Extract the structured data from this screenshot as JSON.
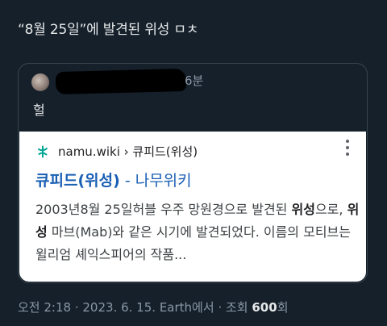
{
  "tweet": {
    "text": "“8월 25일”에 발견된 위성 ㅁㅊ"
  },
  "quote": {
    "time": "6분",
    "body": "헐"
  },
  "search_result": {
    "site": "namu.wiki › 큐피드(위성)",
    "title_main": "큐피드(위성)",
    "title_sep": " - ",
    "title_site": "나무위키",
    "snippet": {
      "p1": "2003년8월 25일허블 우주 망원경으로 발견된 ",
      "b1": "위성",
      "p2": "으로, ",
      "b2": "위성",
      "p3": " 마브(Mab)와 같은 시기에 발견되었다. 이름의 모티브는 윌리엄 셰익스피어의 작품..."
    },
    "favicon": "namu-wiki-icon",
    "menu_icon": "more-vert-icon",
    "accent_color": "#1a5fb4"
  },
  "meta": {
    "time": "오전 2:18",
    "date": "2023. 6. 15.",
    "source": "Earth에서",
    "views_label": "조회",
    "views_count": "600",
    "views_unit": "회"
  }
}
